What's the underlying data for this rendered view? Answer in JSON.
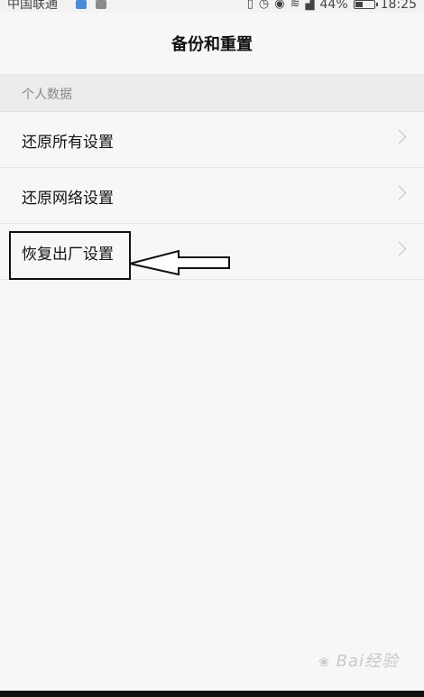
{
  "status_bar": {
    "carrier": "中国联通",
    "battery_percent": "44%",
    "time": "18:25",
    "battery_level": 0.44,
    "icons": [
      "vibrate-icon",
      "alarm-icon",
      "eye-icon",
      "wifi-icon",
      "signal-icon",
      "battery-icon"
    ]
  },
  "header": {
    "title": "备份和重置"
  },
  "section": {
    "title": "个人数据"
  },
  "items": [
    {
      "label": "还原所有设置"
    },
    {
      "label": "还原网络设置"
    },
    {
      "label": "恢复出厂设置"
    }
  ],
  "watermark": {
    "text": "Bai经验"
  }
}
